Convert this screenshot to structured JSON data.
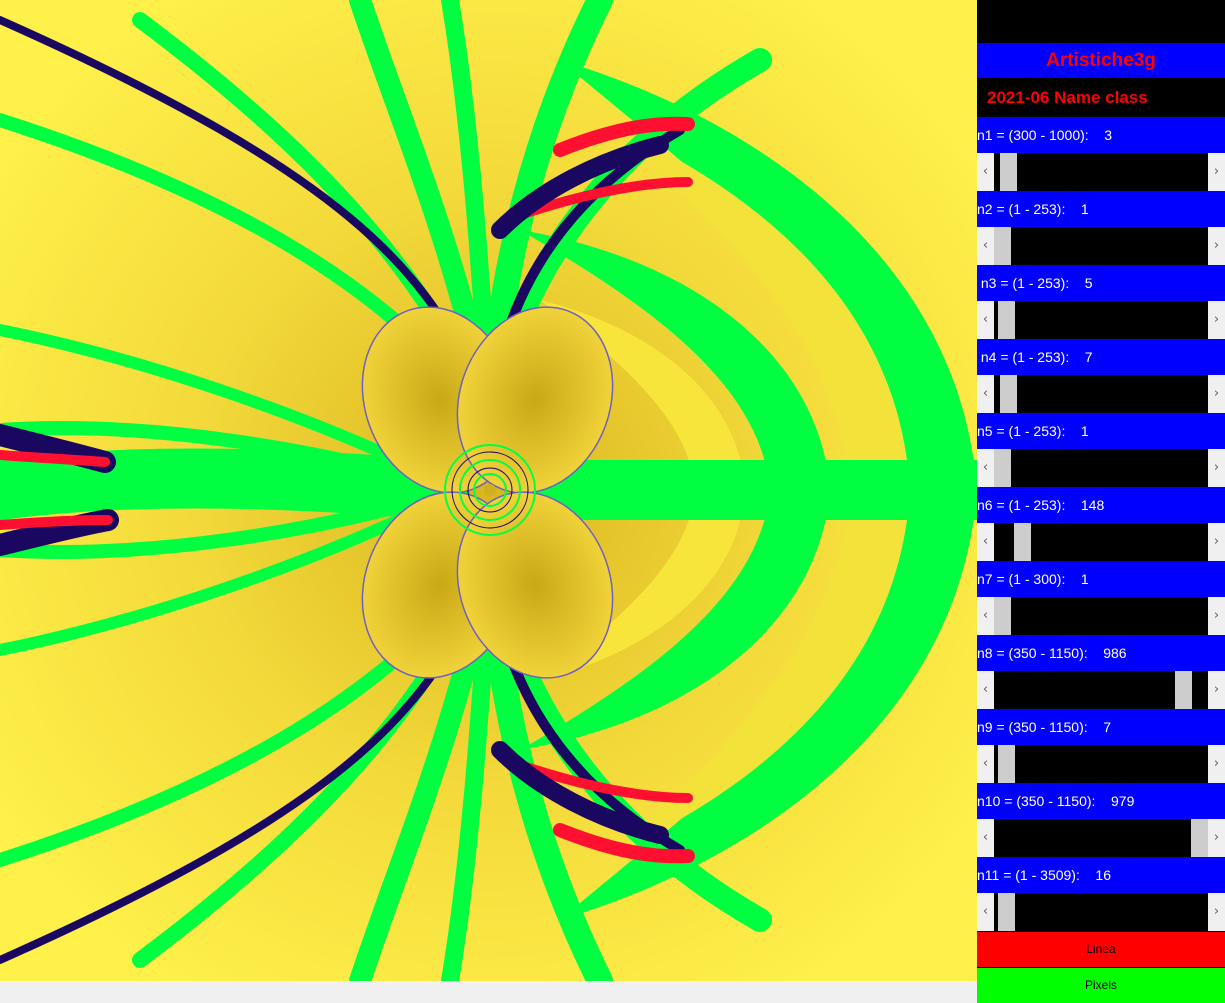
{
  "panel": {
    "title": "Artistiche3g",
    "subtitle": "2021-06  Name class",
    "params": [
      {
        "label": "n1 = (300 - 1000):    3",
        "min": 300,
        "max": 1000,
        "position": 0.03
      },
      {
        "label": "n2 = (1 - 253):    1",
        "min": 1,
        "max": 253,
        "position": 0.0
      },
      {
        "label": " n3 = (1 - 253):    5",
        "min": 1,
        "max": 253,
        "position": 0.02
      },
      {
        "label": " n4 = (1 - 253):    7",
        "min": 1,
        "max": 253,
        "position": 0.03
      },
      {
        "label": "n5 = (1 - 253):    1",
        "min": 1,
        "max": 253,
        "position": 0.0
      },
      {
        "label": "n6 = (1 - 253):    148",
        "min": 1,
        "max": 253,
        "position": 0.1
      },
      {
        "label": "n7 = (1 - 300):    1",
        "min": 1,
        "max": 300,
        "position": 0.0
      },
      {
        "label": "n8 = (350 - 1150):    986",
        "min": 350,
        "max": 1150,
        "position": 0.92
      },
      {
        "label": "n9 = (350 - 1150):    7",
        "min": 350,
        "max": 1150,
        "position": 0.02
      },
      {
        "label": "n10 = (350 - 1150):    979",
        "min": 350,
        "max": 1150,
        "position": 1.0
      },
      {
        "label": "n11 = (1 - 3509):    16",
        "min": 1,
        "max": 3509,
        "position": 0.02
      }
    ],
    "arrows": {
      "left": "‹",
      "right": "›"
    },
    "buttons": {
      "linea": "Linea",
      "pixels": "Pixels"
    }
  },
  "colors": {
    "panel_bg": "#000000",
    "label_bg": "#0000ff",
    "title_text": "#ff0000",
    "linea_bg": "#ff0000",
    "pixels_bg": "#00ff00",
    "fractal_yellow": "#ffe23a",
    "fractal_green": "#00ff40",
    "fractal_red": "#ff1030",
    "fractal_navy": "#1a0860"
  }
}
